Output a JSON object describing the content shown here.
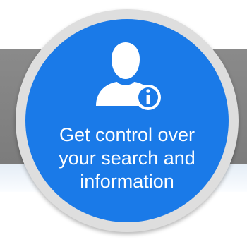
{
  "badge": {
    "icon": "user-info-icon",
    "lines": [
      "Get control over",
      "your search and",
      "information"
    ]
  },
  "colors": {
    "badge_fill": "#1a7ae8",
    "ring": "#dedede",
    "band": "#808080"
  }
}
